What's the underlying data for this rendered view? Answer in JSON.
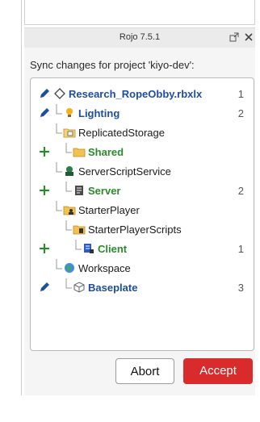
{
  "window": {
    "title": "Rojo 7.5.1"
  },
  "sync_label": "Sync changes for project 'kiyo-dev':",
  "tree": [
    {
      "name": "Research_RopeObby.rbxlx",
      "status": "modified",
      "count": "1",
      "icon": "diamond-icon",
      "style": "bold-blue"
    },
    {
      "name": "Lighting",
      "status": "modified",
      "count": "2",
      "icon": "lightbulb-icon",
      "style": "bold-blue"
    },
    {
      "name": "ReplicatedStorage",
      "status": "",
      "count": "",
      "icon": "replicated-storage-icon",
      "style": "plain"
    },
    {
      "name": "Shared",
      "status": "added",
      "count": "",
      "icon": "folder-icon",
      "style": "bold-green"
    },
    {
      "name": "ServerScriptService",
      "status": "",
      "count": "",
      "icon": "server-script-service-icon",
      "style": "plain"
    },
    {
      "name": "Server",
      "status": "added",
      "count": "2",
      "icon": "script-icon",
      "style": "bold-green"
    },
    {
      "name": "StarterPlayer",
      "status": "",
      "count": "",
      "icon": "starter-player-icon",
      "style": "plain"
    },
    {
      "name": "StarterPlayerScripts",
      "status": "",
      "count": "",
      "icon": "starter-player-scripts-icon",
      "style": "plain"
    },
    {
      "name": "Client",
      "status": "added",
      "count": "1",
      "icon": "local-script-icon",
      "style": "bold-green"
    },
    {
      "name": "Workspace",
      "status": "",
      "count": "",
      "icon": "globe-icon",
      "style": "plain"
    },
    {
      "name": "Baseplate",
      "status": "modified",
      "count": "3",
      "icon": "part-icon",
      "style": "bold-blue"
    }
  ],
  "buttons": {
    "abort": "Abort",
    "accept": "Accept"
  },
  "colors": {
    "accept": "#d92b2b",
    "modified": "#1d4ea6",
    "added": "#2b8a2b"
  }
}
